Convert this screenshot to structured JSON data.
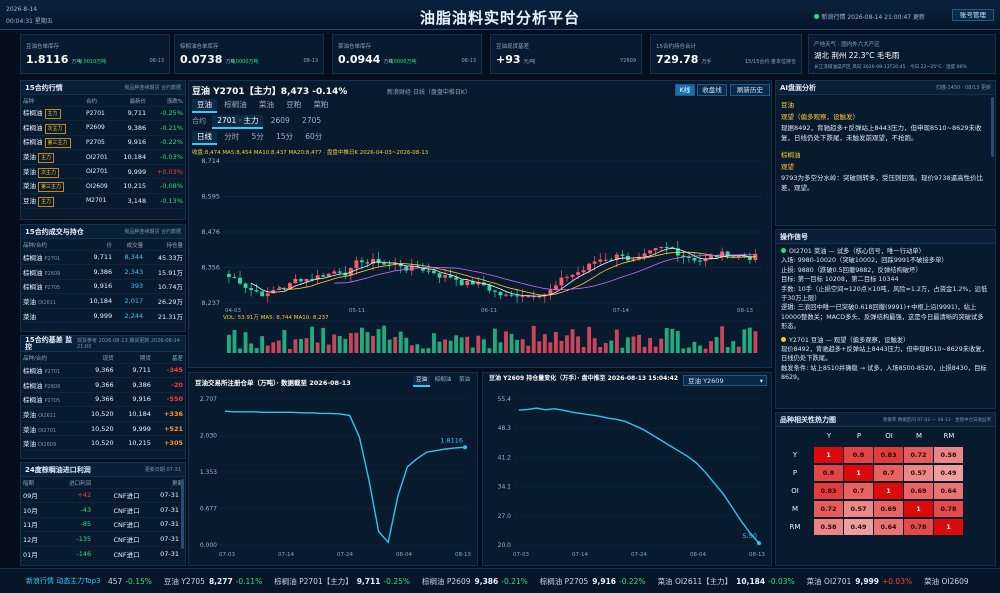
{
  "header": {
    "date": "2026-8-14",
    "time": "00:04:31",
    "weekday": "星期五",
    "title": "油脂油料实时分析平台",
    "status": "新浪行情 2026-08-14 21:00:47 更新",
    "account": "账号管理"
  },
  "kpis": [
    {
      "label": "豆油仓单库存",
      "value": "1.8116",
      "unit": "万吨",
      "change": "-0.0010万吨",
      "date": "08-13",
      "color": "#25e07b"
    },
    {
      "label": "棕榈油仓单库存",
      "value": "0.0738",
      "unit": "万吨",
      "change": "0.0000万吨",
      "date": "08-13",
      "color": "#25e07b"
    },
    {
      "label": "菜油仓单库存",
      "value": "0.0944",
      "unit": "万吨",
      "change": "0.0000万吨",
      "date": "08-13",
      "color": "#25e07b"
    },
    {
      "label": "豆油现货基差",
      "value": "+93",
      "unit": "元/吨",
      "change": "",
      "date": "Y2609",
      "color": "#ff3b3b"
    },
    {
      "label": "15合约持仓合计",
      "value": "729.78",
      "unit": "万手",
      "change": "15/15合约·金本位持仓",
      "date": "",
      "color": "#ff3b3b"
    }
  ],
  "weather": {
    "label": "产地天气 · 国内外六大产区",
    "city": "湖北 荆州 22.3°C 毛毛雨",
    "detail": "长江流域油菜产区  风向 2026-08-13T20:45 · 今日 22~25°C · 湿度 86%"
  },
  "quotes": {
    "title": "15合约行情",
    "subtitle": "我品种连续期货 合约数据",
    "headers": [
      "品种",
      "合约",
      "最新价",
      "涨跌%"
    ],
    "rows": [
      {
        "name": "棕榈油",
        "tag": "主力",
        "code": "P2701",
        "price": "9,711",
        "chg": "-0.25%",
        "dir": "down"
      },
      {
        "name": "棕榈油",
        "tag": "次主力",
        "code": "P2609",
        "price": "9,386",
        "chg": "-0.21%",
        "dir": "down"
      },
      {
        "name": "棕榈油",
        "tag": "第三主力",
        "code": "P2705",
        "price": "9,916",
        "chg": "-0.22%",
        "dir": "down"
      },
      {
        "name": "菜油",
        "tag": "主力",
        "code": "OI2701",
        "price": "10,184",
        "chg": "-0.03%",
        "dir": "down"
      },
      {
        "name": "菜油",
        "tag": "次主力",
        "code": "OI2701",
        "price": "9,999",
        "chg": "+0.03%",
        "dir": "up"
      },
      {
        "name": "菜油",
        "tag": "第三主力",
        "code": "OI2609",
        "price": "10,215",
        "chg": "-0.08%",
        "dir": "down"
      },
      {
        "name": "豆油",
        "tag": "主力",
        "code": "M2701",
        "price": "3,148",
        "chg": "-0.13%",
        "dir": "down"
      }
    ]
  },
  "volume": {
    "title": "15合约成交与持仓",
    "subtitle": "我品种连续期货 合约数据",
    "headers": [
      "品种/合约",
      "价",
      "成交量",
      "持仓量"
    ],
    "rows": [
      {
        "name": "棕榈油",
        "code": "P2701",
        "price": "9,711",
        "vol": "8,344",
        "oi": "45.33万"
      },
      {
        "name": "棕榈油",
        "code": "P2609",
        "price": "9,386",
        "vol": "2,343",
        "oi": "15.91万"
      },
      {
        "name": "棕榈油",
        "code": "P2705",
        "price": "9,916",
        "vol": "393",
        "oi": "10.74万"
      },
      {
        "name": "菜油",
        "code": "OI2611",
        "price": "10,184",
        "vol": "2,017",
        "oi": "26.29万"
      },
      {
        "name": "菜油",
        "code": "",
        "price": "9,999",
        "vol": "2,244",
        "oi": "21.31万"
      }
    ]
  },
  "basis": {
    "title": "15合约基差 监控",
    "subtitle": "现货参考 2026-08-13 期货更新 2026-08-14 21:00",
    "headers": [
      "品种/合约",
      "现货",
      "期货",
      "基差"
    ],
    "rows": [
      {
        "name": "棕榈油",
        "code": "P2701",
        "spot": "9,366",
        "fut": "9,711",
        "basis": "-345",
        "dir": "down"
      },
      {
        "name": "棕榈油",
        "code": "P2609",
        "spot": "9,366",
        "fut": "9,386",
        "basis": "-20",
        "dir": "down"
      },
      {
        "name": "棕榈油",
        "code": "P2705",
        "spot": "9,366",
        "fut": "9,916",
        "basis": "-550",
        "dir": "down"
      },
      {
        "name": "菜油",
        "code": "OI2611",
        "spot": "10,520",
        "fut": "10,184",
        "basis": "+336",
        "dir": "up"
      },
      {
        "name": "菜油",
        "code": "OI2701",
        "spot": "10,520",
        "fut": "9,999",
        "basis": "+521",
        "dir": "up"
      },
      {
        "name": "菜油",
        "code": "OI2609",
        "spot": "10,520",
        "fut": "10,215",
        "basis": "+305",
        "dir": "up"
      }
    ]
  },
  "profit": {
    "title": "24度棕榈油进口利润",
    "subtitle": "更新日期 07-31",
    "headers": [
      "船期",
      "进口利润",
      "",
      "更新"
    ],
    "rows": [
      {
        "m": "09月",
        "v": "+42",
        "t": "CNF进口",
        "d": "07-31",
        "dir": "up"
      },
      {
        "m": "10月",
        "v": "-43",
        "t": "CNF进口",
        "d": "07-31",
        "dir": "down"
      },
      {
        "m": "11月",
        "v": "-85",
        "t": "CNF进口",
        "d": "07-31",
        "dir": "down"
      },
      {
        "m": "12月",
        "v": "-135",
        "t": "CNF进口",
        "d": "07-31",
        "dir": "down"
      },
      {
        "m": "01月",
        "v": "-146",
        "t": "CNF进口",
        "d": "07-31",
        "dir": "down"
      }
    ]
  },
  "main": {
    "title": "豆油 Y2701【主力】8,473 -0.14%",
    "source": "新浪财经 日线（盘盘中推日K）",
    "btns": [
      "K线",
      "收盘线",
      "刷新历史"
    ],
    "tabs": [
      "豆油",
      "棕榈油",
      "菜油",
      "豆粕",
      "菜粕"
    ],
    "contract_label": "合约",
    "contracts": [
      "2701 · 主力",
      "2609",
      "2705"
    ],
    "periods": [
      "日线",
      "分时",
      "5分",
      "15分",
      "60分"
    ],
    "ma_line": "收盘:8,474  MA5:8,454  MA10:8,437  MA20:8,477 · 盘盘中推日K 2026-04-03~2026-08-13",
    "vol_line": "VOL: 53.91万  MA5: 8,744  MA10: 8,237"
  },
  "chart_data": [
    {
      "type": "candlestick",
      "name": "豆油 Y2701 日线",
      "ylim": [
        8237,
        8714
      ],
      "yticks": [
        "8,714",
        "8,595",
        "8,476",
        "8,356",
        "8,237"
      ],
      "xticks": [
        "04-03",
        "05-11",
        "06-11",
        "07-14",
        "08-13"
      ],
      "ma": [
        "MA5",
        "MA10",
        "MA20"
      ]
    },
    {
      "type": "line",
      "title": "豆油交易所注册仓单（万吨）· 数据截至 2026-08-13",
      "tabs": [
        "豆油",
        "棕榈油",
        "菜油"
      ],
      "yticks": [
        "2.707",
        "2.030",
        "1.353",
        "0.677",
        "0.000"
      ],
      "xticks": [
        "07-03",
        "07-14",
        "07-24",
        "08-04",
        "08-13"
      ],
      "ylim": [
        0,
        2.707
      ],
      "last_label": "1.8116",
      "values": [
        2.48,
        2.47,
        2.47,
        2.47,
        2.46,
        2.46,
        2.46,
        2.46,
        2.45,
        2.45,
        2.44,
        2.44,
        2.43,
        2.4,
        2.0,
        1.2,
        0.25,
        0.05,
        0.9,
        1.45,
        1.6,
        1.72,
        1.75,
        1.78,
        1.8,
        1.8116
      ]
    },
    {
      "type": "line",
      "title": "豆油 Y2609 持仓量变化（万手）· 盘中推至 2026-08-13 15:04:42",
      "select": "豆油 Y2609",
      "yticks": [
        "55.4",
        "48.3",
        "41.2",
        "34.1",
        "27.0",
        "20.0"
      ],
      "xticks": [
        "07-03",
        "07-14",
        "07-24",
        "08-04",
        "08-13"
      ],
      "ylim": [
        1.1,
        55.4
      ],
      "last_label": "5.50",
      "values": [
        51.3,
        51.5,
        52.0,
        51.4,
        51.8,
        51.2,
        50.5,
        50.0,
        49.5,
        49.0,
        48.3,
        47.8,
        47.0,
        45.5,
        44.0,
        42.0,
        40.0,
        38.0,
        36.0,
        34.0,
        31.5,
        28.0,
        24.0,
        20.0,
        15.0,
        10.0,
        5.5,
        1.8
      ]
    }
  ],
  "ai": {
    "title": "AI盘面分析",
    "meta": "扫描·1450 · 08/13 更新",
    "sections": [
      {
        "head": "豆油",
        "view": "观望（偏多观察，设触发）",
        "text": "现据8492，背驰趋多+反弹站上8443压力，但申现8510~8629未收复，日线仍处下跌尾，未触发前观望，不抢跑。"
      },
      {
        "head": "棕榈油",
        "view": "观望",
        "text": "9793为多空分水岭：突破则转多，受压则回落。现价9738逼高性价比差，观望。"
      }
    ]
  },
  "signals": {
    "title": "操作信号",
    "items": [
      {
        "dot": "#25e07b",
        "head": "OI2701 菜油 — 试多（核心信号，唯一行动单）",
        "lines": [
          "入场: 9980-10020（突破10002，回踩9991不破接多单）",
          "止损: 9880（跌破0.5回撤9882，反弹结构破坏）",
          "目标: 第一目标 10208，第二目标 10344",
          "手数: 10手（止损空间≈120点×10吨，风险≈1.2万，占资金1.2%，远低于30万上限）",
          "逻辑: 三浪回中唯一已突破0.618回撤(9991)+中枢上沿(9991)，站上10000整数关；MACD多头、反弹结构最强，这是今日最清晰的突破试多形态。"
        ]
      },
      {
        "dot": "#ffcc33",
        "head": "Y2701 豆油 — 观望（偏多观察，设触发）",
        "lines": [
          "现价8492，背驰趋多+反弹站上8443压力，但申现8510~8629未收复，日线仍处下跌尾。",
          "触发条件: 站上8510并确稳 → 试多，入场8500-8520，止损8430，目标8629。"
        ]
      }
    ]
  },
  "heatmap": {
    "title": "品种相关性热力图",
    "sub": "收盘率  数据区间 07-02 — 08-13 · 金盘中仓日收益率",
    "labels": [
      "Y",
      "P",
      "OI",
      "M",
      "RM"
    ],
    "values": [
      [
        1.0,
        0.8,
        0.83,
        0.72,
        0.58
      ],
      [
        0.8,
        1.0,
        0.7,
        0.57,
        0.49
      ],
      [
        0.83,
        0.7,
        1.0,
        0.69,
        0.64
      ],
      [
        0.72,
        0.57,
        0.69,
        1.0,
        0.78
      ],
      [
        0.58,
        0.49,
        0.64,
        0.78,
        1.0
      ]
    ]
  },
  "ticker": {
    "label": "新浪行情 动态主力Top3",
    "items": [
      {
        "n": "457",
        "c": "-0.15%",
        "dir": "down"
      },
      {
        "n": "豆油 Y2705",
        "p": "8,277",
        "c": "-0.11%",
        "dir": "down"
      },
      {
        "n": "棕榈油 P2701【主力】",
        "p": "9,711",
        "c": "-0.25%",
        "dir": "down"
      },
      {
        "n": "棕榈油 P2609",
        "p": "9,386",
        "c": "-0.21%",
        "dir": "down"
      },
      {
        "n": "棕榈油 P2705",
        "p": "9,916",
        "c": "-0.22%",
        "dir": "down"
      },
      {
        "n": "菜油 OI2611【主力】",
        "p": "10,184",
        "c": "-0.03%",
        "dir": "down"
      },
      {
        "n": "菜油 OI2701",
        "p": "9,999",
        "c": "+0.03%",
        "dir": "up"
      },
      {
        "n": "菜油 OI2609",
        "p": "",
        "c": "",
        "dir": "down"
      }
    ]
  }
}
